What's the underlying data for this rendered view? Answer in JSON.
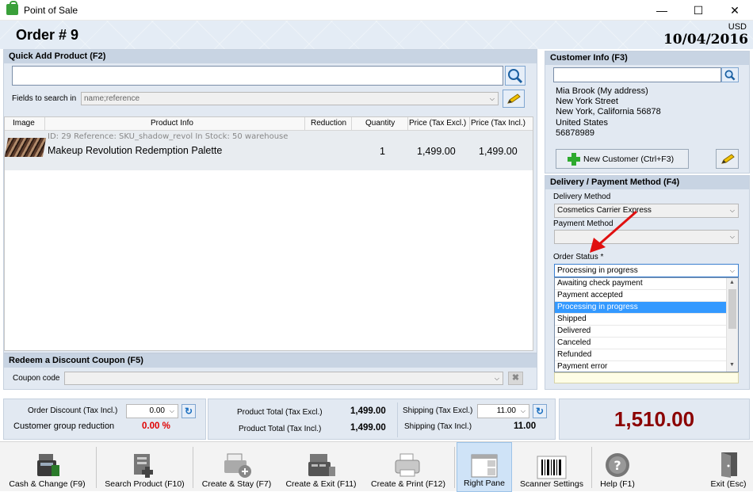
{
  "window": {
    "title": "Point of Sale",
    "minimize": "—",
    "maximize": "☐",
    "close": "✕"
  },
  "header": {
    "order_title": "Order # 9",
    "currency": "USD",
    "date": "10/04/2016"
  },
  "quick_add": {
    "title": "Quick Add Product (F2)",
    "search_value": "",
    "fields_label": "Fields to search in",
    "fields_value": "name;reference"
  },
  "product_grid": {
    "columns": [
      "Image",
      "Product Info",
      "Reduction",
      "Quantity",
      "Price (Tax Excl.)",
      "Price (Tax Incl.)"
    ],
    "rows": [
      {
        "meta": "ID: 29 Reference: SKU_shadow_revol In Stock: 50 warehouse",
        "name": "Makeup Revolution Redemption Palette",
        "quantity": "1",
        "price_excl": "1,499.00",
        "price_incl": "1,499.00"
      }
    ]
  },
  "coupon": {
    "title": "Redeem a Discount Coupon (F5)",
    "label": "Coupon code",
    "value": ""
  },
  "customer": {
    "title": "Customer Info (F3)",
    "search_value": "",
    "address_lines": [
      "Mia Brook (My address)",
      "New York Street",
      "New York, California 56878",
      "United States",
      "56878989"
    ],
    "new_customer_label": "New Customer (Ctrl+F3)"
  },
  "delivery": {
    "title": "Delivery / Payment Method (F4)",
    "delivery_label": "Delivery Method",
    "delivery_value": "Cosmetics Carrier Express",
    "payment_label": "Payment Method",
    "payment_value": "",
    "status_label": "Order Status *",
    "status_value": "Processing in progress",
    "status_options": [
      "Awaiting check payment",
      "Payment accepted",
      "Processing in progress",
      "Shipped",
      "Delivered",
      "Canceled",
      "Refunded",
      "Payment error"
    ],
    "status_selected_index": 2
  },
  "totals": {
    "order_discount_label": "Order Discount (Tax Incl.)",
    "order_discount_value": "0.00",
    "group_reduction_label": "Customer group reduction",
    "group_reduction_value": "0.00 %",
    "product_total_excl_label": "Product Total (Tax Excl.)",
    "product_total_excl_value": "1,499.00",
    "product_total_incl_label": "Product Total (Tax Incl.)",
    "product_total_incl_value": "1,499.00",
    "shipping_excl_label": "Shipping (Tax Excl.)",
    "shipping_excl_value": "11.00",
    "shipping_incl_label": "Shipping (Tax Incl.)",
    "shipping_incl_value": "11.00",
    "grand_total": "1,510.00",
    "grand_total_color": "#8b0000",
    "reduction_color": "#e00000"
  },
  "toolbar": {
    "items": [
      {
        "label": "Cash & Change (F9)",
        "icon": "cash-register-icon"
      },
      {
        "label": "Search Product (F10)",
        "icon": "search-product-icon"
      },
      {
        "label": "Create & Stay (F7)",
        "icon": "printer-add-icon"
      },
      {
        "label": "Create & Exit (F11)",
        "icon": "register-exit-icon"
      },
      {
        "label": "Create & Print (F12)",
        "icon": "printer-icon"
      },
      {
        "label": "Right Pane",
        "icon": "right-pane-icon"
      },
      {
        "label": "Scanner Settings",
        "icon": "barcode-icon"
      },
      {
        "label": "Help (F1)",
        "icon": "help-icon"
      },
      {
        "label": "Exit (Esc)",
        "icon": "exit-door-icon"
      }
    ]
  }
}
